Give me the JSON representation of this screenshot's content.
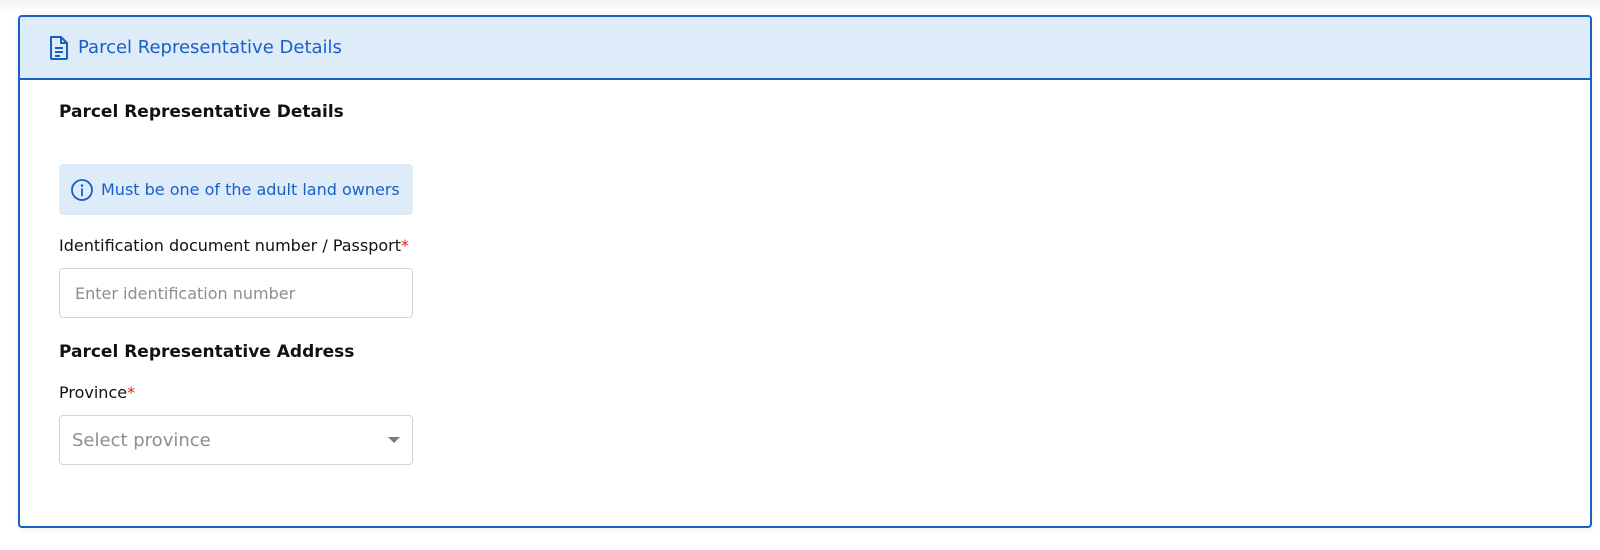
{
  "card": {
    "header_title": "Parcel Representative Details"
  },
  "section1": {
    "title": "Parcel Representative Details",
    "info_text": "Must be one of the adult land owners",
    "id_label": "Identification document number / Passport",
    "required_mark": "*",
    "id_placeholder": "Enter identification number",
    "id_value": ""
  },
  "section2": {
    "title": "Parcel Representative Address",
    "province_label": "Province",
    "required_mark": "*",
    "province_selected": "Select province"
  },
  "icons": {
    "header": "document-icon",
    "info": "info-icon",
    "select": "chevron-down-icon"
  },
  "colors": {
    "accent": "#1a5fc6",
    "header_bg": "#deebf8",
    "required": "#e0201c"
  }
}
